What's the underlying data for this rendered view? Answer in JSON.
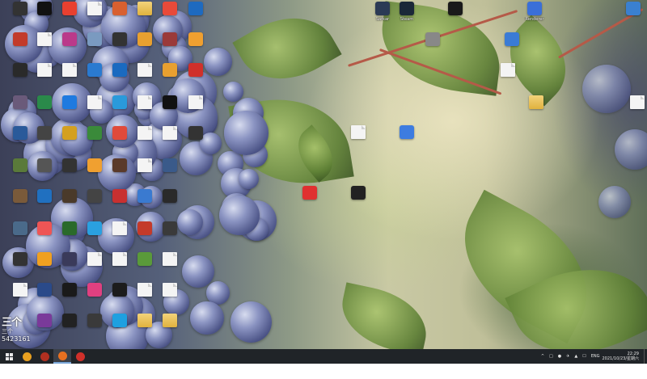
{
  "desktop_icons": [
    {
      "label": "Sarkar",
      "color": "#2b3a55",
      "type": "app"
    },
    {
      "label": "Steam",
      "color": "#1b2838",
      "type": "app"
    },
    {
      "label": "",
      "color": "#1a1a1a",
      "type": "app"
    },
    {
      "label": "Renderer",
      "color": "#3a6fd8",
      "type": "app"
    },
    {
      "label": "",
      "color": "#3a80d0",
      "type": "app"
    },
    {
      "label": "",
      "color": "#888",
      "type": "app"
    },
    {
      "label": "",
      "color": "#3a7bd5",
      "type": "app"
    },
    {
      "label": "",
      "color": "#f0f0f0",
      "type": "file"
    },
    {
      "label": "",
      "color": "#e8c060",
      "type": "folder"
    },
    {
      "label": "",
      "color": "#f0f0f0",
      "type": "file"
    },
    {
      "label": "",
      "color": "#f0f0f0",
      "type": "file"
    },
    {
      "label": "",
      "color": "#3d7ce0",
      "type": "app"
    },
    {
      "label": "",
      "color": "#e03030",
      "type": "app"
    },
    {
      "label": "",
      "color": "#222",
      "type": "app"
    },
    {
      "label": "",
      "color": "#333",
      "type": "app"
    },
    {
      "label": "",
      "color": "#c23b2a",
      "type": "app"
    },
    {
      "label": "",
      "color": "#2a2a2a",
      "type": "app"
    },
    {
      "label": "",
      "color": "#6a5a7a",
      "type": "app"
    },
    {
      "label": "",
      "color": "#2a5a9a",
      "type": "app"
    },
    {
      "label": "",
      "color": "#5a7a3a",
      "type": "app"
    },
    {
      "label": "",
      "color": "#7a5a3a",
      "type": "app"
    },
    {
      "label": "",
      "color": "#4a6a8a",
      "type": "app"
    },
    {
      "label": "",
      "color": "#333",
      "type": "app"
    },
    {
      "label": "",
      "color": "#f0f0f0",
      "type": "file"
    },
    {
      "label": "",
      "color": "#111",
      "type": "app"
    },
    {
      "label": "",
      "color": "#f0f0f0",
      "type": "file"
    },
    {
      "label": "",
      "color": "#f0f0f0",
      "type": "file"
    },
    {
      "label": "",
      "color": "#2a8a4a",
      "type": "app"
    },
    {
      "label": "",
      "color": "#444",
      "type": "app"
    },
    {
      "label": "",
      "color": "#555",
      "type": "app"
    },
    {
      "label": "",
      "color": "#2070c0",
      "type": "app"
    },
    {
      "label": "",
      "color": "#e55",
      "type": "app"
    },
    {
      "label": "",
      "color": "#f0a020",
      "type": "app"
    },
    {
      "label": "",
      "color": "#2a4a8a",
      "type": "app"
    },
    {
      "label": "",
      "color": "#7a3a9a",
      "type": "app"
    },
    {
      "label": "",
      "color": "#e84030",
      "type": "app"
    },
    {
      "label": "",
      "color": "#ba3a8a",
      "type": "app"
    },
    {
      "label": "",
      "color": "#f0f0f0",
      "type": "file"
    },
    {
      "label": "",
      "color": "#1e7ae0",
      "type": "app"
    },
    {
      "label": "",
      "color": "#d4a020",
      "type": "app"
    },
    {
      "label": "",
      "color": "#333",
      "type": "app"
    },
    {
      "label": "",
      "color": "#4a3a2a",
      "type": "app"
    },
    {
      "label": "",
      "color": "#2a6a2a",
      "type": "app"
    },
    {
      "label": "",
      "color": "#3a3a5a",
      "type": "app"
    },
    {
      "label": "",
      "color": "#1a1a1a",
      "type": "app"
    },
    {
      "label": "",
      "color": "#222",
      "type": "app"
    },
    {
      "label": "",
      "color": "#f0f0f0",
      "type": "file"
    },
    {
      "label": "",
      "color": "#7a9ac0",
      "type": "app"
    },
    {
      "label": "",
      "color": "#2a7ad0",
      "type": "app"
    },
    {
      "label": "",
      "color": "#f0f0f0",
      "type": "file"
    },
    {
      "label": "",
      "color": "#3a8a3a",
      "type": "app"
    },
    {
      "label": "",
      "color": "#f0a030",
      "type": "app"
    },
    {
      "label": "",
      "color": "#444",
      "type": "app"
    },
    {
      "label": "",
      "color": "#2aa0e0",
      "type": "app"
    },
    {
      "label": "",
      "color": "#f0f0f0",
      "type": "file"
    },
    {
      "label": "",
      "color": "#e04080",
      "type": "app"
    },
    {
      "label": "",
      "color": "#3a3a3a",
      "type": "app"
    },
    {
      "label": "",
      "color": "#d86030",
      "type": "app"
    },
    {
      "label": "",
      "color": "#333",
      "type": "app"
    },
    {
      "label": "",
      "color": "#1a6ac0",
      "type": "app"
    },
    {
      "label": "",
      "color": "#2a9adb",
      "type": "app"
    },
    {
      "label": "",
      "color": "#e04a3a",
      "type": "app"
    },
    {
      "label": "",
      "color": "#5a3a2a",
      "type": "app"
    },
    {
      "label": "",
      "color": "#c83030",
      "type": "app"
    },
    {
      "label": "",
      "color": "#f0f0f0",
      "type": "file"
    },
    {
      "label": "",
      "color": "#f0f0f0",
      "type": "file"
    },
    {
      "label": "",
      "color": "#1c1c1c",
      "type": "app"
    },
    {
      "label": "",
      "color": "#1ea0e0",
      "type": "app"
    },
    {
      "label": "",
      "color": "#e8c060",
      "type": "folder"
    },
    {
      "label": "",
      "color": "#e8a030",
      "type": "app"
    },
    {
      "label": "",
      "color": "#f0f0f0",
      "type": "file"
    },
    {
      "label": "",
      "color": "#f0f0f0",
      "type": "file"
    },
    {
      "label": "",
      "color": "#f0f0f0",
      "type": "file"
    },
    {
      "label": "",
      "color": "#f0f0f0",
      "type": "file"
    },
    {
      "label": "",
      "color": "#3a7ad0",
      "type": "app"
    },
    {
      "label": "",
      "color": "#c43a2a",
      "type": "app"
    },
    {
      "label": "",
      "color": "#5a9a3a",
      "type": "app"
    },
    {
      "label": "",
      "color": "#f0f0f0",
      "type": "file"
    },
    {
      "label": "",
      "color": "#e8c060",
      "type": "folder"
    },
    {
      "label": "",
      "color": "#e84a3a",
      "type": "app"
    },
    {
      "label": "",
      "color": "#9a3a3a",
      "type": "app"
    },
    {
      "label": "",
      "color": "#e8a030",
      "type": "app"
    },
    {
      "label": "",
      "color": "#111",
      "type": "app"
    },
    {
      "label": "",
      "color": "#f0f0f0",
      "type": "file"
    },
    {
      "label": "",
      "color": "#3a5a8a",
      "type": "app"
    },
    {
      "label": "",
      "color": "#2a2a2a",
      "type": "app"
    },
    {
      "label": "",
      "color": "#3a3a3a",
      "type": "app"
    },
    {
      "label": "",
      "color": "#f0f0f0",
      "type": "file"
    },
    {
      "label": "",
      "color": "#f0f0f0",
      "type": "file"
    },
    {
      "label": "",
      "color": "#e8c060",
      "type": "folder"
    },
    {
      "label": "",
      "color": "#1e6ac0",
      "type": "app"
    },
    {
      "label": "",
      "color": "#f0a030",
      "type": "app"
    },
    {
      "label": "",
      "color": "#d0302a",
      "type": "app"
    },
    {
      "label": "",
      "color": "#f0f0f0",
      "type": "file"
    },
    {
      "label": "",
      "color": "#333",
      "type": "app"
    }
  ],
  "taskbar": {
    "pinned": [
      {
        "name": "start",
        "color": "#e8e8e8"
      },
      {
        "name": "chrome",
        "color": "#e8a020"
      },
      {
        "name": "app",
        "color": "#b03020"
      },
      {
        "name": "app-active",
        "color": "#e87020"
      },
      {
        "name": "netease",
        "color": "#d0302a"
      }
    ],
    "tray_icons": [
      "^",
      "□",
      "●",
      "✈",
      "▲",
      "☐",
      "ENG"
    ],
    "time": "22:29",
    "date": "2021/10/23/星期六"
  },
  "watermark": {
    "logo": "三个",
    "sub": "三个",
    "number": "5423161"
  },
  "colors": {
    "taskbar": "#202428"
  }
}
